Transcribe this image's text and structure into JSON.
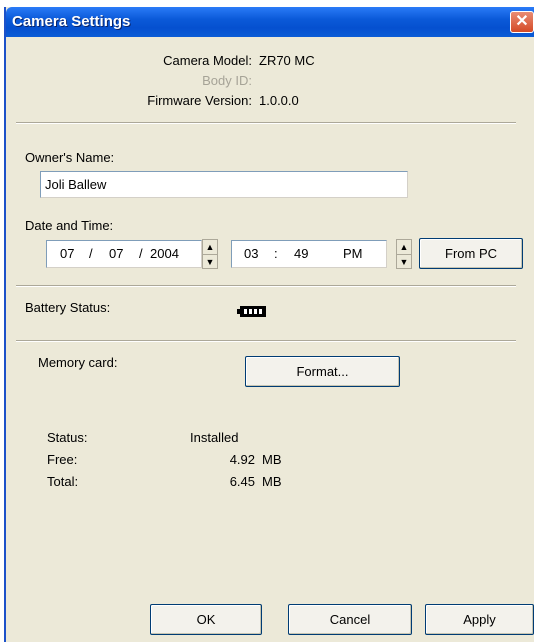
{
  "window": {
    "title": "Camera Settings",
    "close_glyph": "✕"
  },
  "info": {
    "model_label": "Camera Model:",
    "model_value": "ZR70 MC",
    "body_label": "Body ID:",
    "body_value": "",
    "firmware_label": "Firmware Version:",
    "firmware_value": "1.0.0.0"
  },
  "owner": {
    "label": "Owner's Name:",
    "value": "Joli Ballew"
  },
  "datetime": {
    "label": "Date and Time:",
    "month": "07",
    "sep1": "/",
    "day": "07",
    "sep2": "/",
    "year": "2004",
    "hour": "03",
    "colon": ":",
    "minute": "49",
    "ampm": "PM",
    "from_pc_label": "From PC"
  },
  "battery": {
    "label": "Battery Status:",
    "icon": "battery-icon"
  },
  "memory": {
    "label": "Memory card:",
    "format_label": "Format...",
    "status_label": "Status:",
    "status_value": "Installed",
    "free_label": "Free:",
    "free_value": "4.92",
    "free_unit": "MB",
    "total_label": "Total:",
    "total_value": "6.45",
    "total_unit": "MB"
  },
  "buttons": {
    "ok": "OK",
    "cancel": "Cancel",
    "apply": "Apply"
  }
}
